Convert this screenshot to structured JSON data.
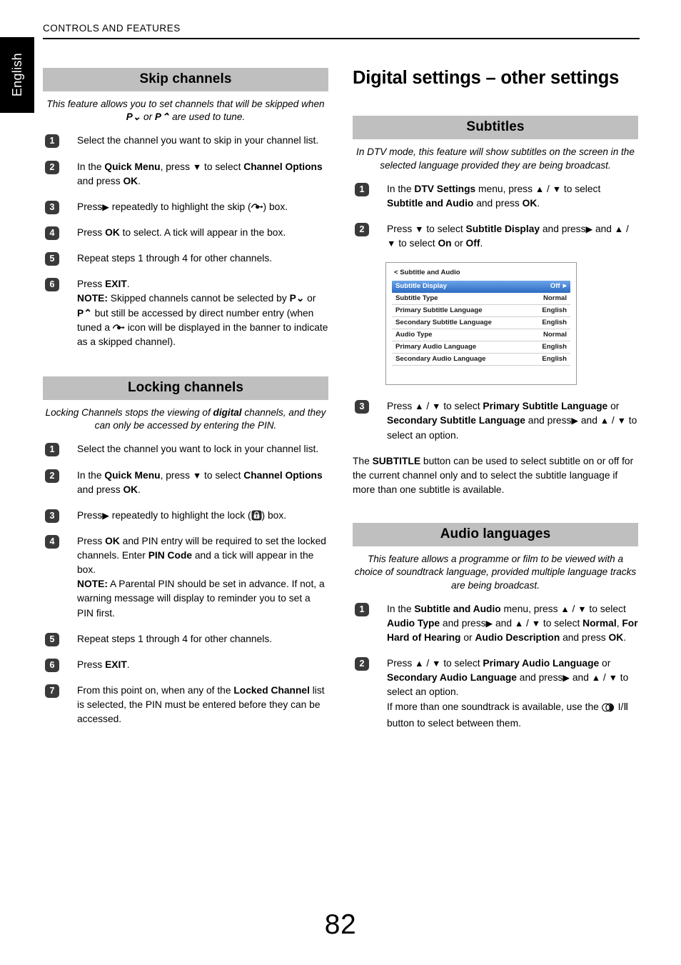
{
  "page": {
    "running_head": "CONTROLS AND FEATURES",
    "language_tab": "English",
    "page_number": "82"
  },
  "left_column": {
    "sections": [
      {
        "heading": "Skip channels",
        "intro_parts": [
          {
            "text": "This feature allows you to set channels that will be skipped when ",
            "bold": false
          },
          {
            "text": "P",
            "bold": true
          },
          {
            "text": "∨",
            "bold": true
          },
          {
            "text": " or ",
            "bold": false
          },
          {
            "text": "P",
            "bold": true
          },
          {
            "text": "∧",
            "bold": true
          },
          {
            "text": " are used to tune.",
            "bold": false
          }
        ],
        "intro_plain": "This feature allows you to set channels that will be skipped when P∨ or P∧ are used to tune.",
        "steps": [
          {
            "number": "1",
            "text": "Select the channel you want to skip in your channel list."
          },
          {
            "number": "2",
            "text": "In the Quick Menu, press ▼ to select Channel Options and press OK."
          },
          {
            "number": "3",
            "text": "Press ▶ repeatedly to highlight the skip (skip-icon) box."
          },
          {
            "number": "4",
            "text": "Press OK to select. A tick will appear in the box."
          },
          {
            "number": "5",
            "text": "Repeat steps 1 through 4 for other channels."
          },
          {
            "number": "6",
            "text": "Press EXIT."
          }
        ],
        "note": "NOTE: Skipped channels cannot be selected by P∨ or P∧ but still be accessed by direct number entry (when tuned a skip-icon icon will be displayed in the banner to indicate as a skipped channel)."
      },
      {
        "heading": "Locking channels",
        "intro_plain": "Locking Channels stops the viewing of digital channels, and they can only be accessed by entering the PIN.",
        "steps": [
          {
            "number": "1",
            "text": "Select the channel you want to lock in your channel list."
          },
          {
            "number": "2",
            "text": "In the Quick Menu, press ▼ to select Channel Options and press OK."
          },
          {
            "number": "3",
            "text": "Press ▶ repeatedly to highlight the lock (lock-icon) box."
          },
          {
            "number": "4",
            "text": "Press OK and PIN entry will be required to set the locked channels. Enter PIN Code and a tick will appear in the box."
          },
          {
            "number": "5",
            "text": "Repeat steps 1 through 4 for other channels."
          },
          {
            "number": "6",
            "text": "Press EXIT."
          },
          {
            "number": "7",
            "text": "From this point on, when any of the Locked Channel list is selected, the PIN must be entered before they can be accessed."
          }
        ],
        "note": "NOTE: A Parental PIN should be set in advance. If not, a warning message will display to reminder you to set a PIN first."
      }
    ]
  },
  "right_column": {
    "chapter_title": "Digital settings – other settings",
    "sections": [
      {
        "heading": "Subtitles",
        "intro_plain": "In DTV mode, this feature will show subtitles on the screen in the selected language provided they are being broadcast.",
        "steps": [
          {
            "number": "1",
            "text": "In the DTV Settings menu, press ▲ / ▼ to select Subtitle and Audio and press OK."
          },
          {
            "number": "2",
            "text": "Press ▼ to select Subtitle Display and press ▶ and ▲ / ▼ to select On or Off."
          },
          {
            "number": "3",
            "text": "Press ▲ / ▼ to select Primary Subtitle Language or Secondary Subtitle Language and press ▶ and ▲ / ▼ to select an option."
          }
        ],
        "closing": "The SUBTITLE button can be used to select subtitle on or off for the current channel only and to select the subtitle language if more than one subtitle is available."
      },
      {
        "heading": "Audio languages",
        "intro_plain": "This feature allows a programme or film to be viewed with a choice of soundtrack language, provided multiple language tracks are being broadcast.",
        "steps": [
          {
            "number": "1",
            "text": "In the Subtitle and Audio menu, press ▲ / ▼ to select Audio Type and press ▶ and ▲ / ▼ to select Normal, For Hard of Hearing or Audio Description and press OK."
          },
          {
            "number": "2",
            "text": "Press ▲ / ▼ to select Primary Audio Language or Secondary Audio Language and press ▶ and ▲ / ▼ to select an option."
          }
        ],
        "closing": "If more than one soundtrack is available, use the dual-sound-icon I/II button to select between them."
      }
    ]
  },
  "tv_menu": {
    "title": "< Subtitle and Audio",
    "selected_index": 0,
    "rows": [
      {
        "label": "Subtitle Display",
        "value": "Off",
        "caret": "▶"
      },
      {
        "label": "Subtitle Type",
        "value": "Normal"
      },
      {
        "label": "Primary Subtitle Language",
        "value": "English"
      },
      {
        "label": "Secondary Subtitle Language",
        "value": "English"
      },
      {
        "label": "Audio Type",
        "value": "Normal"
      },
      {
        "label": "Primary Audio Language",
        "value": "English"
      },
      {
        "label": "Secondary Audio Language",
        "value": "English"
      }
    ]
  },
  "colors": {
    "banner_grey": "#bfbfbf",
    "badge_dark": "#3a3a3a",
    "menu_highlight_blue": "#2f6fc4",
    "tab_black": "#000000"
  }
}
